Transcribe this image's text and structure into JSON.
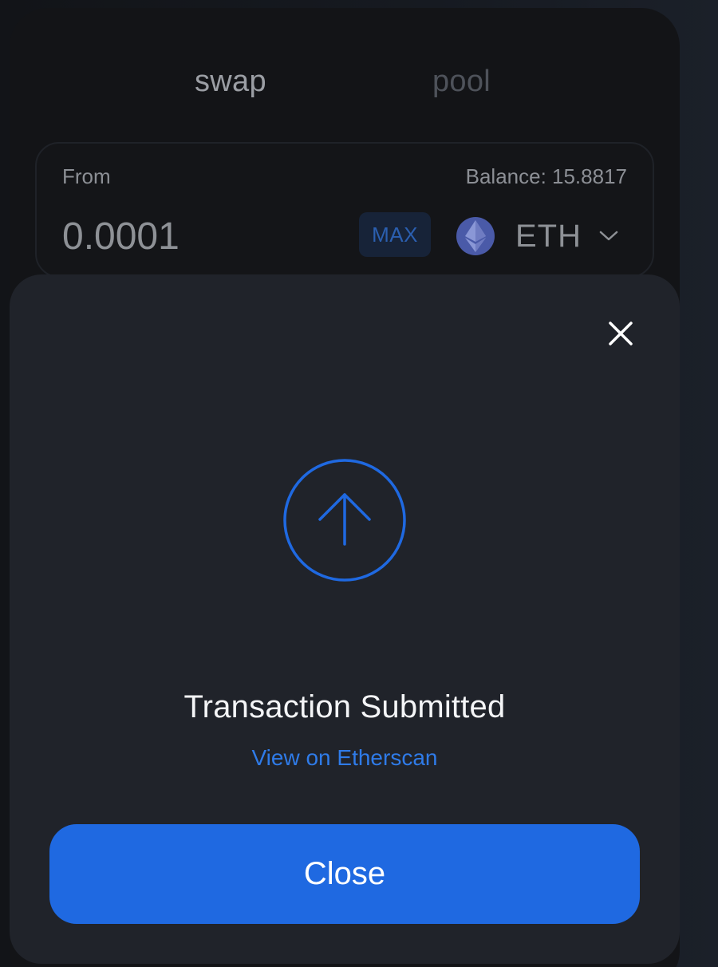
{
  "tabs": {
    "swap_label": "swap",
    "pool_label": "pool"
  },
  "from_panel": {
    "label": "From",
    "balance_text": "Balance: 15.8817",
    "amount_value": "0.0001",
    "max_label": "MAX",
    "token_symbol": "ETH",
    "token_icon": "ethereum-icon"
  },
  "modal": {
    "status_icon": "arrow-up-circle-icon",
    "title": "Transaction Submitted",
    "link_text": "View on Etherscan",
    "close_button_label": "Close",
    "close_icon": "close-icon"
  },
  "colors": {
    "accent": "#1f69e1",
    "link": "#2f7be8",
    "modal_bg": "#20232a",
    "card_bg": "#131417"
  }
}
